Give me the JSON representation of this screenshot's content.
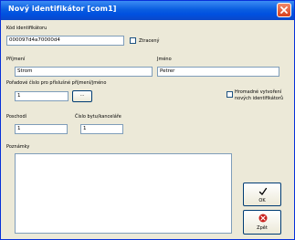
{
  "window": {
    "title": "Nový identifikátor [com1]"
  },
  "form": {
    "code_label": "Kód identifikátoru",
    "code_value": "000097d4a70000d4",
    "lost_label": "Ztracený",
    "surname_label": "Příjmení",
    "surname_value": "Strom",
    "name_label": "Jméno",
    "name_value": "Petrer",
    "order_label": "Pořadové číslo pro příslušné příjmení/jméno",
    "order_value": "1",
    "browse_label": "...",
    "bulk_label_1": "Hromadné vytvoření",
    "bulk_label_2": "nových identifikátorů",
    "floor_label": "Poschodí",
    "floor_value": "1",
    "office_label": "Číslo bytu/kanceláře",
    "office_value": "1",
    "notes_label": "Poznámky",
    "notes_value": ""
  },
  "buttons": {
    "ok_label": "OK",
    "back_label": "Zpět"
  },
  "colors": {
    "titlebar": "#0a5ee0",
    "ok_check": "#000000",
    "back_icon": "#c8201c"
  }
}
